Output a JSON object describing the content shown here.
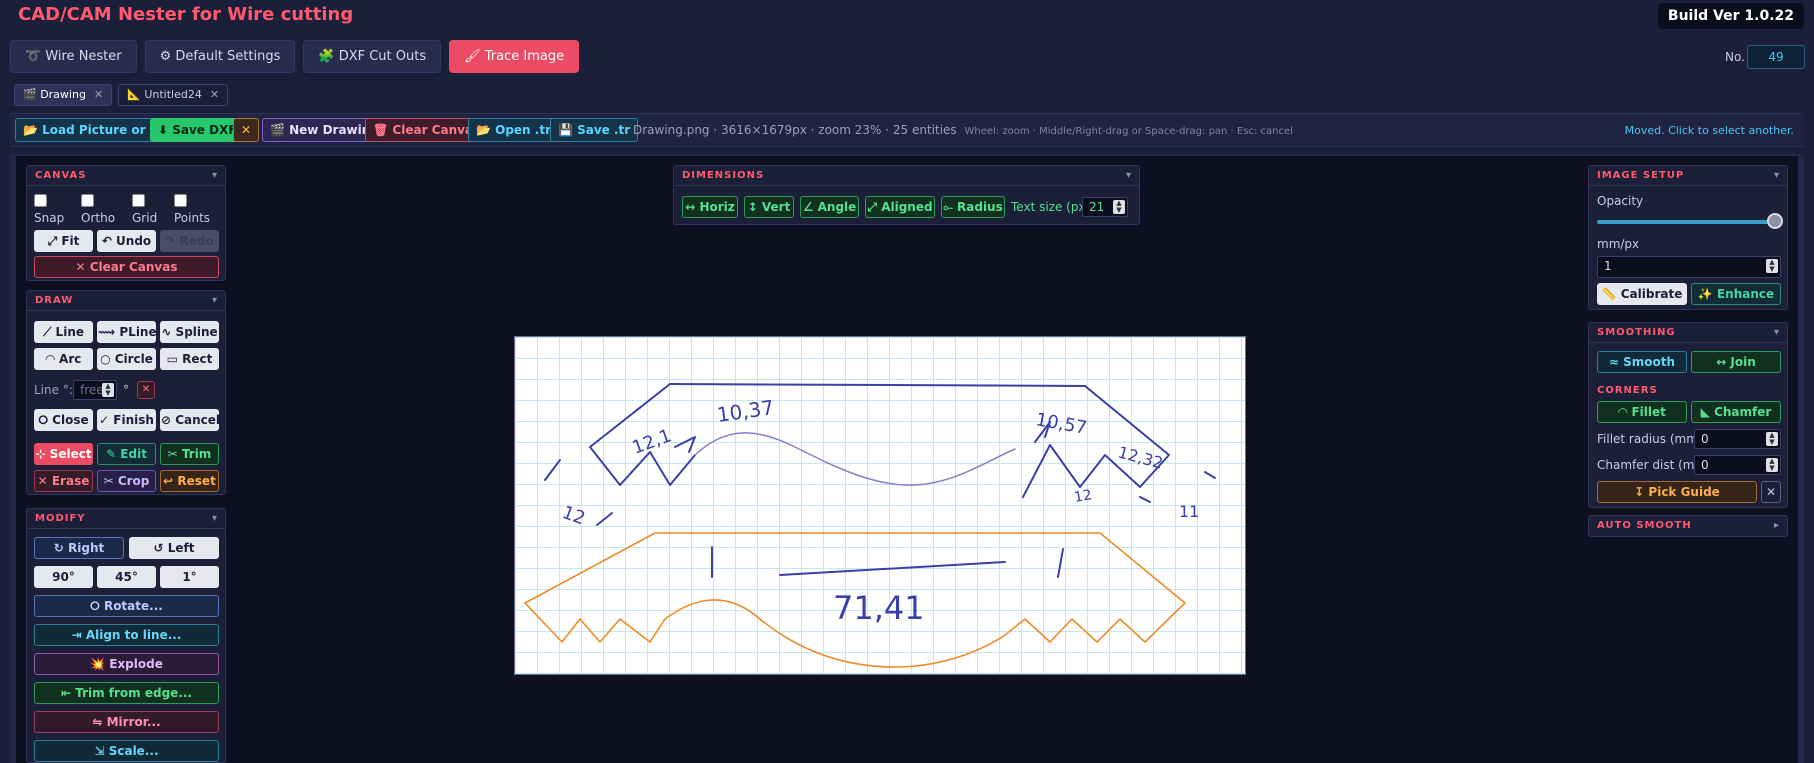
{
  "app": {
    "title": "CAD/CAM Nester for Wire cutting",
    "build": "Build Ver 1.0.22"
  },
  "main_tabs": [
    {
      "label": "➰ Wire Nester"
    },
    {
      "label": "⚙ Default Settings"
    },
    {
      "label": "🧩 DXF Cut Outs"
    },
    {
      "label": "🖌 Trace Image"
    }
  ],
  "counter": {
    "label": "No.",
    "value": "49"
  },
  "doc_tabs": [
    {
      "label": "🎬 Drawing",
      "close": "✕"
    },
    {
      "label": "📐 Untitled24",
      "close": "✕"
    }
  ],
  "toolbar": {
    "load": "📂 Load Picture or DXF",
    "save_dxf": "⬇ Save DXF",
    "close": "✕",
    "new_drawing": "🎬 New Drawing",
    "clear_canvas": "🗑 Clear Canvas",
    "open_tr": "📂 Open .tr",
    "save_tr": "💾 Save .tr",
    "info": "Drawing.png · 3616×1679px · zoom 23% · 25 entities",
    "hint": "Wheel: zoom · Middle/Right-drag or Space-drag: pan · Esc: cancel",
    "status": "Moved. Click to select another."
  },
  "canvas_panel": {
    "title": "CANVAS",
    "caret": "▾",
    "snap": "Snap",
    "ortho": "Ortho",
    "grid": "Grid",
    "points": "Points",
    "fit": "⤢ Fit",
    "undo": "↶ Undo",
    "redo": "↷ Redo",
    "clear": "✕ Clear Canvas"
  },
  "draw_panel": {
    "title": "DRAW",
    "caret": "▾",
    "line": "⟋ Line",
    "pline": "⟿ PLine",
    "spline": "∿ Spline",
    "arc": "◠ Arc",
    "circle": "○ Circle",
    "rect": "▭ Rect",
    "line_angle_label": "Line °:",
    "line_angle_placeholder": "free",
    "deg": "°",
    "clear_x": "✕",
    "close": "⭘ Close",
    "finish": "✓ Finish",
    "cancel": "⊘ Cancel",
    "select": "⊹ Select",
    "edit": "✎ Edit",
    "trim": "✂ Trim",
    "erase": "✕ Erase",
    "crop": "✂ Crop",
    "reset": "↩ Reset"
  },
  "modify_panel": {
    "title": "MODIFY",
    "caret": "▾",
    "right": "↻ Right",
    "left": "↺ Left",
    "d90": "90°",
    "d45": "45°",
    "d1": "1°",
    "rotate": "⭘ Rotate...",
    "align": "⇥ Align to line...",
    "explode": "💥 Explode",
    "trim_edge": "⇤ Trim from edge...",
    "mirror": "⇋ Mirror...",
    "scale": "⇲ Scale..."
  },
  "dimensions_panel": {
    "title": "DIMENSIONS",
    "caret": "▾",
    "horiz": "↔ Horiz",
    "vert": "↕ Vert",
    "angle": "∠ Angle",
    "aligned": "⤢ Aligned",
    "radius": "⟜ Radius",
    "text_size_label": "Text size (px)",
    "text_size": "21"
  },
  "image_setup_panel": {
    "title": "IMAGE SETUP",
    "caret": "▾",
    "opacity_label": "Opacity",
    "opacity": 1.0,
    "mmpx_label": "mm/px",
    "mmpx": "1",
    "calibrate": "📏 Calibrate",
    "enhance": "✨ Enhance"
  },
  "smoothing_panel": {
    "title": "SMOOTHING",
    "caret": "▾",
    "smooth": "≈ Smooth",
    "join": "↔ Join",
    "corners_title": "CORNERS",
    "fillet": "◠ Fillet",
    "chamfer": "◣ Chamfer",
    "fillet_label": "Fillet radius (mm)",
    "fillet_value": "0",
    "chamfer_label": "Chamfer dist (mm)",
    "chamfer_value": "0",
    "pick_guide": "↧ Pick Guide",
    "pick_x": "✕"
  },
  "auto_smooth_panel": {
    "title": "AUTO SMOOTH",
    "caret": "▸"
  },
  "sketch": {
    "n1": "10,37",
    "n2": "12,1",
    "n3": "12",
    "n4": "10,57",
    "n5": "12,32",
    "n6": "12",
    "n7": "11",
    "n8": "71,41"
  },
  "colors": {
    "accent": "#ec4c63",
    "trace": "#f08a24",
    "sketch": "#3b3fa8"
  }
}
